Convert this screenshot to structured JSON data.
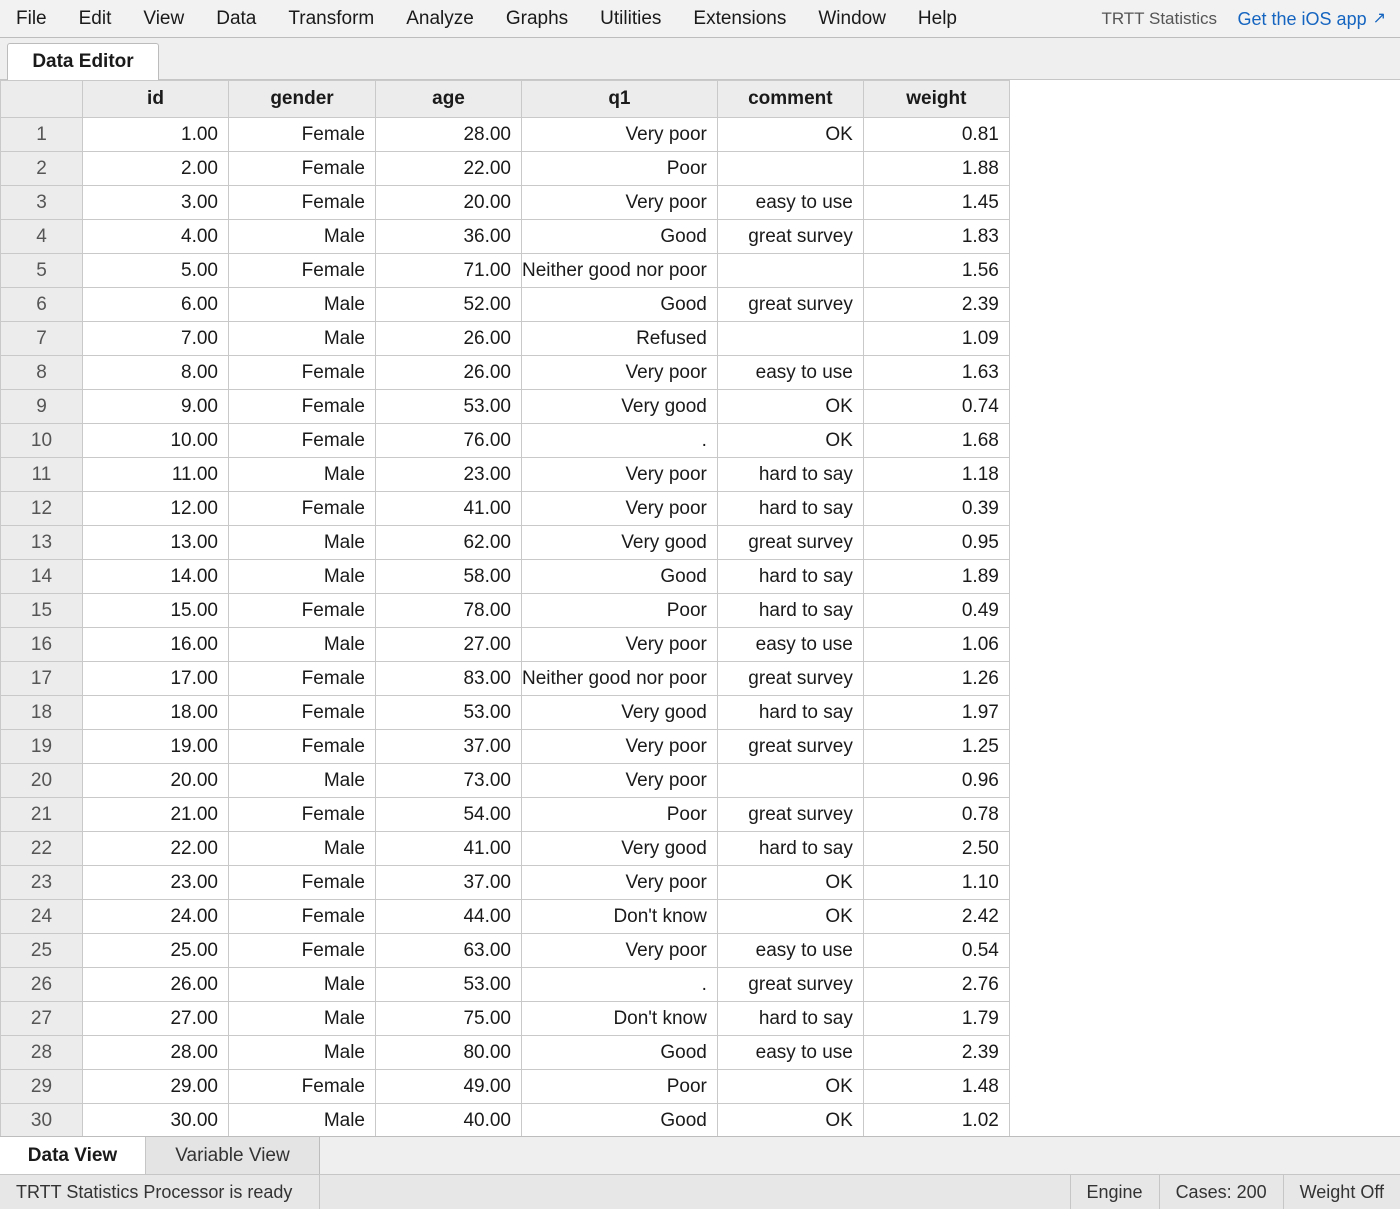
{
  "menubar": {
    "items": [
      "File",
      "Edit",
      "View",
      "Data",
      "Transform",
      "Analyze",
      "Graphs",
      "Utilities",
      "Extensions",
      "Window",
      "Help"
    ],
    "brand": "TRTT Statistics",
    "ios_link": "Get the iOS app",
    "ios_link_icon": "external-arrow-icon"
  },
  "editor": {
    "tab_label": "Data Editor"
  },
  "grid": {
    "columns": [
      "id",
      "gender",
      "age",
      "q1",
      "comment",
      "weight"
    ],
    "rows": [
      [
        "1",
        "1.00",
        "Female",
        "28.00",
        "Very poor",
        "OK",
        "0.81"
      ],
      [
        "2",
        "2.00",
        "Female",
        "22.00",
        "Poor",
        "",
        "1.88"
      ],
      [
        "3",
        "3.00",
        "Female",
        "20.00",
        "Very poor",
        "easy to use",
        "1.45"
      ],
      [
        "4",
        "4.00",
        "Male",
        "36.00",
        "Good",
        "great survey",
        "1.83"
      ],
      [
        "5",
        "5.00",
        "Female",
        "71.00",
        "Neither good nor poor",
        "",
        "1.56"
      ],
      [
        "6",
        "6.00",
        "Male",
        "52.00",
        "Good",
        "great survey",
        "2.39"
      ],
      [
        "7",
        "7.00",
        "Male",
        "26.00",
        "Refused",
        "",
        "1.09"
      ],
      [
        "8",
        "8.00",
        "Female",
        "26.00",
        "Very poor",
        "easy to use",
        "1.63"
      ],
      [
        "9",
        "9.00",
        "Female",
        "53.00",
        "Very good",
        "OK",
        "0.74"
      ],
      [
        "10",
        "10.00",
        "Female",
        "76.00",
        ".",
        "OK",
        "1.68"
      ],
      [
        "11",
        "11.00",
        "Male",
        "23.00",
        "Very poor",
        "hard to say",
        "1.18"
      ],
      [
        "12",
        "12.00",
        "Female",
        "41.00",
        "Very poor",
        "hard to say",
        "0.39"
      ],
      [
        "13",
        "13.00",
        "Male",
        "62.00",
        "Very good",
        "great survey",
        "0.95"
      ],
      [
        "14",
        "14.00",
        "Male",
        "58.00",
        "Good",
        "hard to say",
        "1.89"
      ],
      [
        "15",
        "15.00",
        "Female",
        "78.00",
        "Poor",
        "hard to say",
        "0.49"
      ],
      [
        "16",
        "16.00",
        "Male",
        "27.00",
        "Very poor",
        "easy to use",
        "1.06"
      ],
      [
        "17",
        "17.00",
        "Female",
        "83.00",
        "Neither good nor poor",
        "great survey",
        "1.26"
      ],
      [
        "18",
        "18.00",
        "Female",
        "53.00",
        "Very good",
        "hard to say",
        "1.97"
      ],
      [
        "19",
        "19.00",
        "Female",
        "37.00",
        "Very poor",
        "great survey",
        "1.25"
      ],
      [
        "20",
        "20.00",
        "Male",
        "73.00",
        "Very poor",
        "",
        "0.96"
      ],
      [
        "21",
        "21.00",
        "Female",
        "54.00",
        "Poor",
        "great survey",
        "0.78"
      ],
      [
        "22",
        "22.00",
        "Male",
        "41.00",
        "Very good",
        "hard to say",
        "2.50"
      ],
      [
        "23",
        "23.00",
        "Female",
        "37.00",
        "Very poor",
        "OK",
        "1.10"
      ],
      [
        "24",
        "24.00",
        "Female",
        "44.00",
        "Don't know",
        "OK",
        "2.42"
      ],
      [
        "25",
        "25.00",
        "Female",
        "63.00",
        "Very poor",
        "easy to use",
        "0.54"
      ],
      [
        "26",
        "26.00",
        "Male",
        "53.00",
        ".",
        "great survey",
        "2.76"
      ],
      [
        "27",
        "27.00",
        "Male",
        "75.00",
        "Don't know",
        "hard to say",
        "1.79"
      ],
      [
        "28",
        "28.00",
        "Male",
        "80.00",
        "Good",
        "easy to use",
        "2.39"
      ],
      [
        "29",
        "29.00",
        "Female",
        "49.00",
        "Poor",
        "OK",
        "1.48"
      ],
      [
        "30",
        "30.00",
        "Male",
        "40.00",
        "Good",
        "OK",
        "1.02"
      ]
    ]
  },
  "view_tabs": {
    "data_view": "Data View",
    "variable_view": "Variable View"
  },
  "status": {
    "message": "TRTT Statistics Processor is ready",
    "engine": "Engine",
    "cases": "Cases: 200",
    "weight": "Weight Off"
  }
}
